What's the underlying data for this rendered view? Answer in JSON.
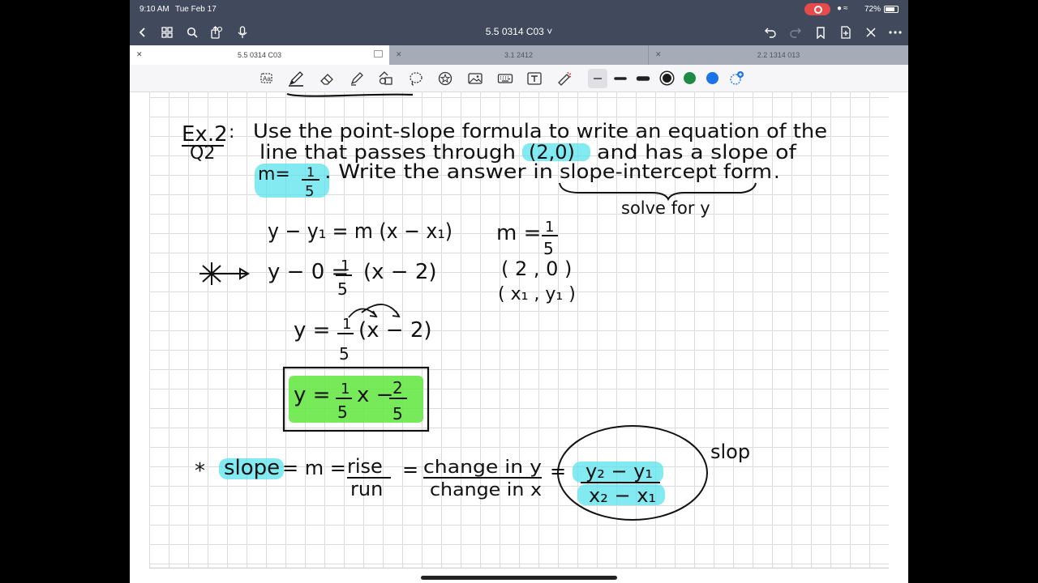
{
  "status": {
    "time": "9:10 AM",
    "date": "Tue Feb 17",
    "battery": "72%"
  },
  "nav": {
    "title": "5.5 0314 C03 ˅"
  },
  "tabs": [
    {
      "label": "5.5 0314 C03"
    },
    {
      "label": "3.1 2412"
    },
    {
      "label": "2.2 1314 013"
    }
  ],
  "toolbar": {
    "tools": [
      "lasso-text-icon",
      "pen-icon",
      "eraser-icon",
      "highlighter-icon",
      "shapes-icon",
      "lasso-icon",
      "sticker-icon",
      "image-icon",
      "keyboard-icon",
      "text-box-icon",
      "laser-pointer-icon"
    ],
    "colors": [
      "#1a1a1a",
      "#1f8a46",
      "#1a73e8"
    ]
  },
  "notes": {
    "ex_label": "Ex.2",
    "q_label": "Q2",
    "problem_line1": "Use the point-slope formula to write an equation of the",
    "problem_line2a": "line that passes through",
    "problem_point": "(2,0)",
    "problem_line2b": "and has a slope of",
    "problem_m": "m=",
    "problem_frac_num": "1",
    "problem_frac_den": "5",
    "problem_line3a": ". Write the answer in",
    "problem_form": "slope-intercept form",
    "problem_period": ".",
    "solve_note": "solve for y",
    "formula": "y − y₁ = m (x − x₁)",
    "given_m": "m =",
    "given_num": "1",
    "given_den": "5",
    "given_point": "( 2 , 0 )",
    "given_labels": "( x₁ , y₁ )",
    "step1_left": "y − 0 =",
    "step1_num": "1",
    "step1_den": "5",
    "step1_right": "(x − 2)",
    "step2_left": "y =",
    "step2_num": "1",
    "step2_den": "5",
    "step2_right": "(x − 2)",
    "answer_left": "y =",
    "answer_num1": "1",
    "answer_den1": "5",
    "answer_mid": "x −",
    "answer_num2": "2",
    "answer_den2": "5",
    "def_star": "*",
    "def_slope": "slope",
    "def_eq1": "= m =",
    "def_rise": "rise",
    "def_run": "run",
    "def_eq2": "=",
    "def_change_y": "change in y",
    "def_change_x": "change in x",
    "def_eq3": "=",
    "def_y_diff": "y₂ − y₁",
    "def_x_diff": "x₂ − x₁",
    "side_note": "slop"
  }
}
